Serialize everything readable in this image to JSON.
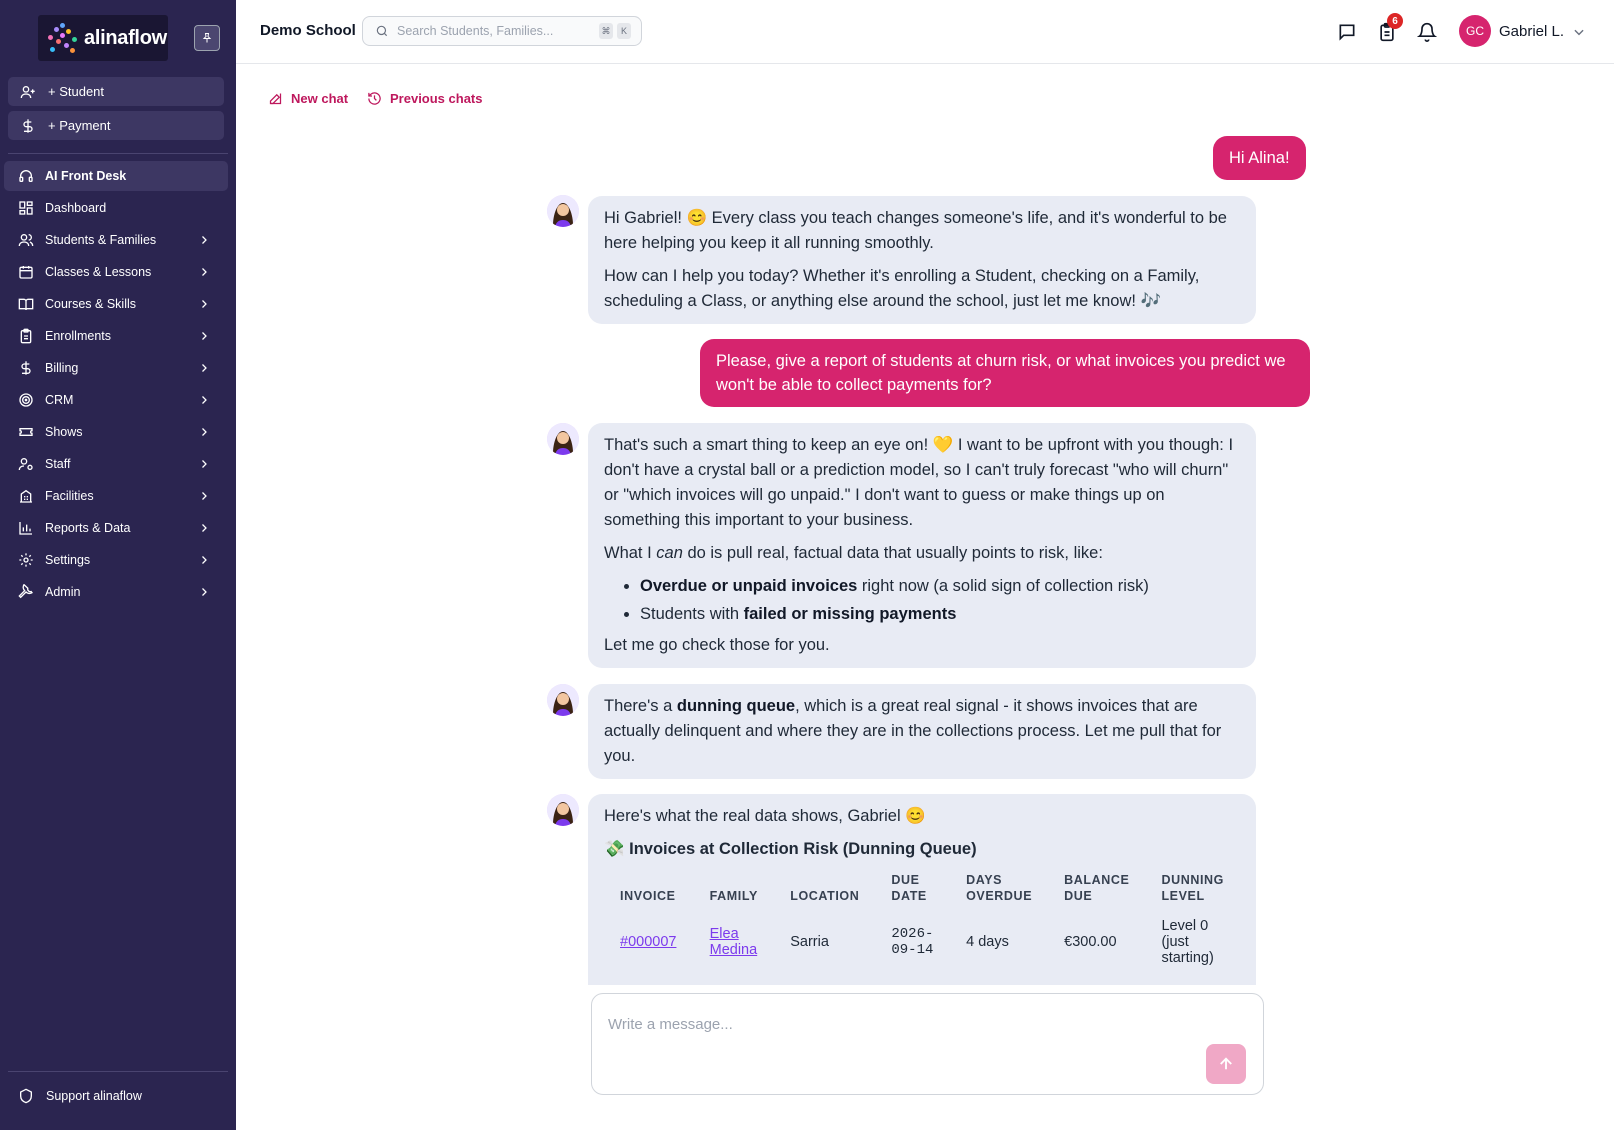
{
  "brand": {
    "name": "alinaflow"
  },
  "sidebar": {
    "quick_actions": [
      {
        "label": "+ Student",
        "icon": "user-plus-icon"
      },
      {
        "label": "+ Payment",
        "icon": "dollar-icon"
      }
    ],
    "items": [
      {
        "label": "AI Front Desk",
        "icon": "headset-icon",
        "active": true
      },
      {
        "label": "Dashboard",
        "icon": "dashboard-icon"
      },
      {
        "label": "Students & Families",
        "icon": "users-icon"
      },
      {
        "label": "Classes & Lessons",
        "icon": "calendar-icon"
      },
      {
        "label": "Courses & Skills",
        "icon": "book-icon"
      },
      {
        "label": "Enrollments",
        "icon": "clipboard-icon"
      },
      {
        "label": "Billing",
        "icon": "dollar-icon"
      },
      {
        "label": "CRM",
        "icon": "target-icon"
      },
      {
        "label": "Shows",
        "icon": "ticket-icon"
      },
      {
        "label": "Staff",
        "icon": "user-gear-icon"
      },
      {
        "label": "Facilities",
        "icon": "building-icon"
      },
      {
        "label": "Reports & Data",
        "icon": "bar-chart-icon"
      },
      {
        "label": "Settings",
        "icon": "gear-icon"
      },
      {
        "label": "Admin",
        "icon": "wrench-icon"
      }
    ],
    "support_label": "Support alinaflow"
  },
  "header": {
    "school_name": "Demo School",
    "search_placeholder": "Search Students, Families...",
    "shortcut_keys": [
      "⌘",
      "K"
    ],
    "notification_count": "6",
    "user_initials": "GC",
    "user_name": "Gabriel L."
  },
  "chat": {
    "new_chat_label": "New chat",
    "previous_chats_label": "Previous chats",
    "messages": {
      "user_1": "Hi Alina!",
      "bot_1_p1": "Hi Gabriel! 😊 Every class you teach changes someone's life, and it's wonderful to be here helping you keep it all running smoothly.",
      "bot_1_p2": "How can I help you today? Whether it's enrolling a Student, checking on a Family, scheduling a Class, or anything else around the school, just let me know! 🎶",
      "user_2": "Please, give a report of students at churn risk, or what invoices you predict we won't be able to collect payments for?",
      "bot_2_p1": "That's such a smart thing to keep an eye on! 💛 I want to be upfront with you though: I don't have a crystal ball or a prediction model, so I can't truly forecast \"who will churn\" or \"which invoices will go unpaid.\" I don't want to guess or make things up on something this important to your business.",
      "bot_2_p2_a": "What I ",
      "bot_2_p2_em": "can",
      "bot_2_p2_b": " do is pull real, factual data that usually points to risk, like:",
      "bot_2_li1_bold": "Overdue or unpaid invoices",
      "bot_2_li1_rest": " right now (a solid sign of collection risk)",
      "bot_2_li2_pre": "Students with ",
      "bot_2_li2_bold": "failed or missing payments",
      "bot_2_p3": "Let me go check those for you.",
      "bot_3_pre": "There's a ",
      "bot_3_bold": "dunning queue",
      "bot_3_rest": ", which is a great real signal - it shows invoices that are actually delinquent and where they are in the collections process. Let me pull that for you.",
      "bot_4_p1": "Here's what the real data shows, Gabriel 😊",
      "bot_4_title": "💸 Invoices at Collection Risk (Dunning Queue)"
    },
    "table": {
      "headers": [
        "INVOICE",
        "FAMILY",
        "LOCATION",
        "DUE DATE",
        "DAYS OVERDUE",
        "BALANCE DUE",
        "DUNNING LEVEL"
      ],
      "rows": [
        {
          "invoice": "#000007",
          "family": "Elea Medina",
          "location": "Sarria",
          "due_date": "2026-09-14",
          "days_overdue": "4 days",
          "balance": "€300.00",
          "level": "Level 0 (just starting)"
        }
      ]
    },
    "composer_placeholder": "Write a message..."
  },
  "colors": {
    "sidebar_bg": "#2b2550",
    "accent": "#d6246e",
    "bot_bubble": "#e8ebf4",
    "link": "#7c3aed"
  }
}
